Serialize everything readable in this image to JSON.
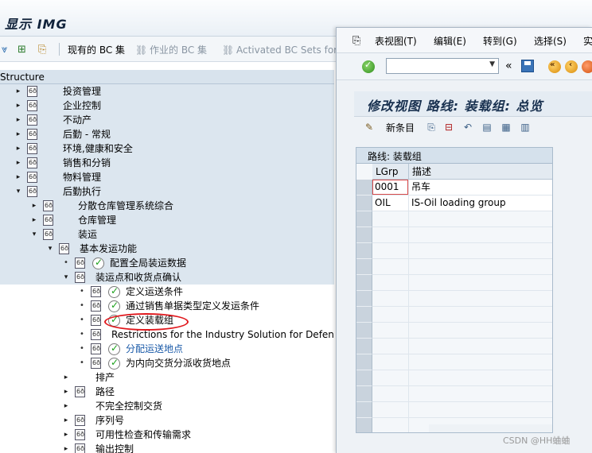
{
  "window": {
    "title": "显示 IMG"
  },
  "toolbar": {
    "current_bc_sets": "现有的 BC 集",
    "activity_bc_sets": "作业的 BC 集",
    "activated_bc_sets": "Activated BC Sets for A"
  },
  "structure": {
    "header": "Structure",
    "rows": [
      {
        "label": "投资管理",
        "level": 1,
        "expander": "▸",
        "icon": "document-icon",
        "shaded": true
      },
      {
        "label": "企业控制",
        "level": 1,
        "expander": "▸",
        "icon": "document-icon",
        "shaded": true
      },
      {
        "label": "不动产",
        "level": 1,
        "expander": "▸",
        "icon": "document-icon",
        "shaded": true
      },
      {
        "label": "后勤 - 常规",
        "level": 1,
        "expander": "▸",
        "icon": "document-icon",
        "shaded": true
      },
      {
        "label": "环境,健康和安全",
        "level": 1,
        "expander": "▸",
        "icon": "document-icon",
        "shaded": true
      },
      {
        "label": "销售和分销",
        "level": 1,
        "expander": "▸",
        "icon": "document-icon",
        "shaded": true
      },
      {
        "label": "物料管理",
        "level": 1,
        "expander": "▸",
        "icon": "document-icon",
        "shaded": true
      },
      {
        "label": "后勤执行",
        "level": 1,
        "expander": "▾",
        "icon": "document-icon",
        "shaded": true
      },
      {
        "label": "分散仓库管理系统综合",
        "level": 2,
        "expander": "▸",
        "icon": "document-icon",
        "shaded": true
      },
      {
        "label": "仓库管理",
        "level": 2,
        "expander": "▸",
        "icon": "document-icon",
        "shaded": true
      },
      {
        "label": "装运",
        "level": 2,
        "expander": "▾",
        "icon": "document-icon",
        "shaded": true
      },
      {
        "label": "基本发运功能",
        "level": 3,
        "expander": "▾",
        "icon": "document-icon",
        "shaded": true
      },
      {
        "label": "配置全局装运数据",
        "level": 4,
        "expander": "•",
        "icon": "document-icon",
        "check": true,
        "shaded": true
      },
      {
        "label": "装运点和收货点确认",
        "level": 4,
        "expander": "▾",
        "icon": "document-icon",
        "shaded": true
      },
      {
        "label": "定义运送条件",
        "level": 5,
        "expander": "•",
        "icon": "document-icon",
        "check": true
      },
      {
        "label": "通过销售单据类型定义发运条件",
        "level": 5,
        "expander": "•",
        "icon": "document-icon",
        "check": true
      },
      {
        "label": "定义装载组",
        "level": 5,
        "expander": "•",
        "icon": "document-icon",
        "check": true
      },
      {
        "label": "Restrictions for the Industry Solution for Defense",
        "level": 5,
        "expander": "•",
        "icon": "document-icon"
      },
      {
        "label": "分配运送地点",
        "level": 5,
        "expander": "•",
        "icon": "document-icon",
        "check": true,
        "link": true
      },
      {
        "label": "为内向交货分派收货地点",
        "level": 5,
        "expander": "•",
        "icon": "document-icon",
        "check": true
      },
      {
        "label": "排产",
        "level": 4,
        "expander": "▸",
        "icon": "none"
      },
      {
        "label": "路径",
        "level": 4,
        "expander": "▸",
        "icon": "document-icon"
      },
      {
        "label": "不完全控制交货",
        "level": 4,
        "expander": "▸",
        "icon": "none"
      },
      {
        "label": "序列号",
        "level": 4,
        "expander": "▸",
        "icon": "document-icon"
      },
      {
        "label": "可用性检查和传输需求",
        "level": 4,
        "expander": "▸",
        "icon": "document-icon"
      },
      {
        "label": "输出控制",
        "level": 4,
        "expander": "▸",
        "icon": "document-icon"
      }
    ]
  },
  "dialog": {
    "menu": [
      "表视图(T)",
      "编辑(E)",
      "转到(G)",
      "选择(S)",
      "实"
    ],
    "title": "修改视图 路线: 装载组: 总览",
    "new_entries": "新条目",
    "table_title": "路线: 装载组",
    "columns": [
      "LGrp",
      "描述"
    ],
    "rows": [
      {
        "lgrp": "0001",
        "desc": "吊车"
      },
      {
        "lgrp": "OIL",
        "desc": "IS-Oil loading group"
      }
    ]
  },
  "watermark": "CSDN @HH蛐蛐"
}
